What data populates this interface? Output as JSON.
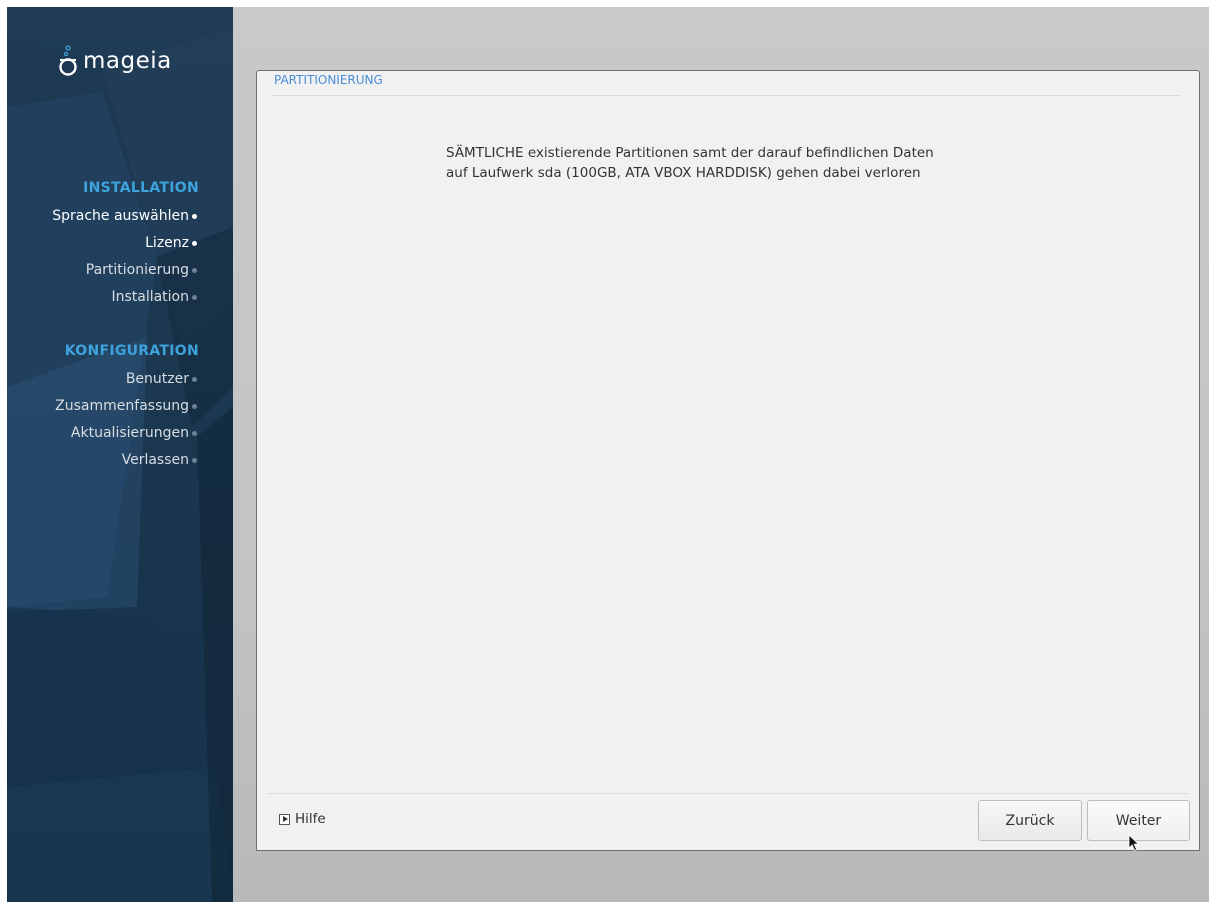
{
  "sidebar": {
    "logo_text": "mageia",
    "sections": [
      {
        "title": "INSTALLATION",
        "steps": [
          {
            "label": "Sprache auswählen",
            "state": "done"
          },
          {
            "label": "Lizenz",
            "state": "done"
          },
          {
            "label": "Partitionierung",
            "state": "current"
          },
          {
            "label": "Installation",
            "state": "todo"
          }
        ]
      },
      {
        "title": "KONFIGURATION",
        "steps": [
          {
            "label": "Benutzer",
            "state": "todo"
          },
          {
            "label": "Zusammenfassung",
            "state": "todo"
          },
          {
            "label": "Aktualisierungen",
            "state": "todo"
          },
          {
            "label": "Verlassen",
            "state": "todo"
          }
        ]
      }
    ]
  },
  "panel": {
    "title": "PARTITIONIERUNG",
    "message_line1": "SÄMTLICHE existierende Partitionen samt der darauf befindlichen Daten",
    "message_line2": "auf Laufwerk sda (100GB, ATA VBOX HARDDISK) gehen dabei verloren",
    "help_label": "Hilfe",
    "back_label": "Zurück",
    "next_label": "Weiter"
  },
  "colors": {
    "accent": "#3ea3dc",
    "title_blue": "#4a8fd6",
    "sidebar_bg": "#1b3850"
  },
  "icons": {
    "logo": "mageia-cauldron-icon",
    "help": "disclosure-triangle-icon",
    "cursor": "mouse-pointer-icon"
  }
}
